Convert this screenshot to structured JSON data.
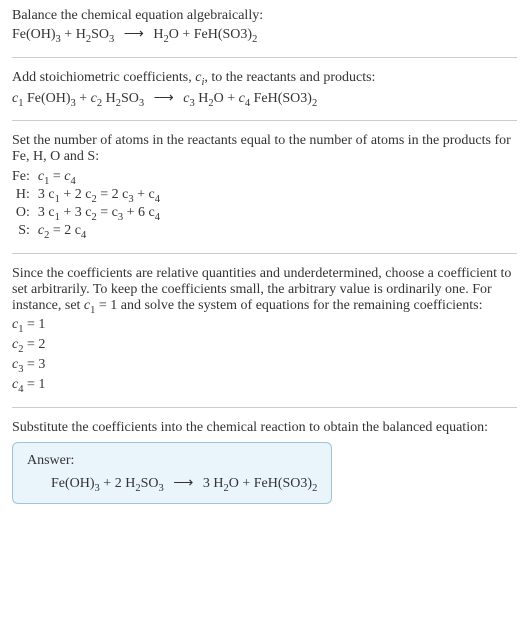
{
  "title": "Balance the chemical equation algebraically:",
  "unbalanced_equation": {
    "lhs": [
      {
        "formula": "Fe(OH)",
        "sub": "3"
      },
      {
        "formula": "H",
        "sub": "2",
        "tail": "SO",
        "tailsub": "3"
      }
    ],
    "arrow": "⟶",
    "rhs": [
      {
        "formula": "H",
        "sub": "2",
        "tail": "O"
      },
      {
        "formula": "FeH(SO3)",
        "sub": "2"
      }
    ]
  },
  "add_stoich_text": "Add stoichiometric coefficients, ",
  "add_stoich_var": "c",
  "add_stoich_var_sub": "i",
  "add_stoich_tail": ", to the reactants and products:",
  "stoich_equation": {
    "terms_lhs": [
      {
        "coef": "c",
        "coef_sub": "1",
        "formula": "Fe(OH)",
        "sub": "3"
      },
      {
        "coef": "c",
        "coef_sub": "2",
        "formula": "H",
        "sub": "2",
        "tail": "SO",
        "tailsub": "3"
      }
    ],
    "arrow": "⟶",
    "terms_rhs": [
      {
        "coef": "c",
        "coef_sub": "3",
        "formula": "H",
        "sub": "2",
        "tail": "O"
      },
      {
        "coef": "c",
        "coef_sub": "4",
        "formula": "FeH(SO3)",
        "sub": "2"
      }
    ]
  },
  "atoms_intro": "Set the number of atoms in the reactants equal to the number of atoms in the products for Fe, H, O and S:",
  "atoms": [
    {
      "el": "Fe:",
      "lhs": "c",
      "lhs_sub": "1",
      "eq": " = ",
      "rhs": "c",
      "rhs_sub": "4"
    },
    {
      "el": "H:",
      "t1": "3 c",
      "s1": "1",
      "p1": " + 2 c",
      "s2": "2",
      "eq": " = 2 c",
      "s3": "3",
      "p2": " + c",
      "s4": "4"
    },
    {
      "el": "O:",
      "t1": "3 c",
      "s1": "1",
      "p1": " + 3 c",
      "s2": "2",
      "eq": " = c",
      "s3": "3",
      "p2": " + 6 c",
      "s4": "4"
    },
    {
      "el": "S:",
      "lhs": "c",
      "lhs_sub": "2",
      "eq": " = 2 c",
      "rhs_sub": "4"
    }
  ],
  "underdet_text": "Since the coefficients are relative quantities and underdetermined, choose a coefficient to set arbitrarily. To keep the coefficients small, the arbitrary value is ordinarily one. For instance, set ",
  "underdet_var": "c",
  "underdet_var_sub": "1",
  "underdet_tail": " = 1 and solve the system of equations for the remaining coefficients:",
  "solutions": [
    {
      "v": "c",
      "s": "1",
      "eq": " = 1"
    },
    {
      "v": "c",
      "s": "2",
      "eq": " = 2"
    },
    {
      "v": "c",
      "s": "3",
      "eq": " = 3"
    },
    {
      "v": "c",
      "s": "4",
      "eq": " = 1"
    }
  ],
  "substitute_text": "Substitute the coefficients into the chemical reaction to obtain the balanced equation:",
  "answer_label": "Answer:",
  "balanced_equation": {
    "lhs": [
      {
        "coef": "",
        "formula": "Fe(OH)",
        "sub": "3"
      },
      {
        "coef": "2 ",
        "formula": "H",
        "sub": "2",
        "tail": "SO",
        "tailsub": "3"
      }
    ],
    "arrow": "⟶",
    "rhs": [
      {
        "coef": "3 ",
        "formula": "H",
        "sub": "2",
        "tail": "O"
      },
      {
        "coef": "",
        "formula": "FeH(SO3)",
        "sub": "2"
      }
    ]
  }
}
